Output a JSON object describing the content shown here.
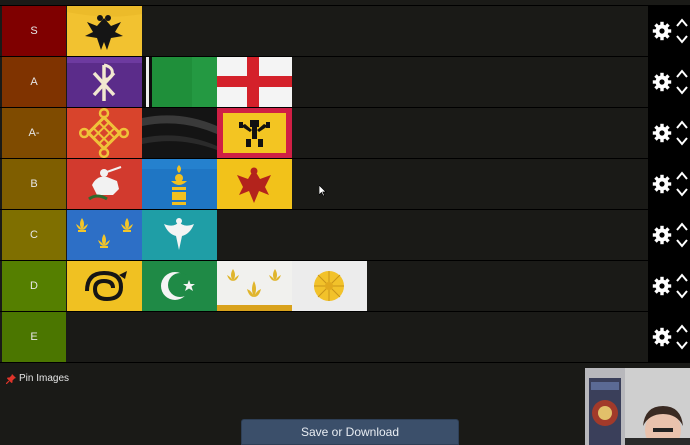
{
  "tiers": [
    {
      "label": "S",
      "color": "#7f0000",
      "items": [
        {
          "icon": "black-eagle-flag-icon"
        }
      ]
    },
    {
      "label": "A",
      "color": "#7f3300",
      "items": [
        {
          "icon": "chi-rho-flag-icon"
        },
        {
          "icon": "green-black-flag-icon"
        },
        {
          "icon": "st-george-cross-flag-icon"
        }
      ]
    },
    {
      "label": "A-",
      "color": "#7f4b00",
      "items": [
        {
          "icon": "endless-knot-flag-icon"
        },
        {
          "icon": "black-banner-flag-icon"
        },
        {
          "icon": "figure-emblem-flag-icon"
        }
      ]
    },
    {
      "label": "B",
      "color": "#7f5e00",
      "items": [
        {
          "icon": "st-george-rider-flag-icon"
        },
        {
          "icon": "soyombo-flag-icon"
        },
        {
          "icon": "red-eagle-flag-icon"
        }
      ]
    },
    {
      "label": "C",
      "color": "#7f6f00",
      "items": [
        {
          "icon": "fleur-de-lis-blue-flag-icon"
        },
        {
          "icon": "white-bird-teal-flag-icon"
        }
      ]
    },
    {
      "label": "D",
      "color": "#557f00",
      "items": [
        {
          "icon": "dragon-yellow-flag-icon"
        },
        {
          "icon": "crescent-star-flag-icon"
        },
        {
          "icon": "fleur-de-lis-white-flag-icon"
        },
        {
          "icon": "chrysanthemum-flag-icon"
        }
      ]
    },
    {
      "label": "E",
      "color": "#4b7600",
      "items": []
    }
  ],
  "controls": {
    "settings_icon": "gear-icon",
    "up_icon": "chevron-up-icon",
    "down_icon": "chevron-down-icon"
  },
  "pin": {
    "label": "Pin Images",
    "icon": "pushpin-icon"
  },
  "save_button": {
    "label": "Save or Download"
  },
  "webcam": {
    "icon": "webcam-overlay"
  }
}
